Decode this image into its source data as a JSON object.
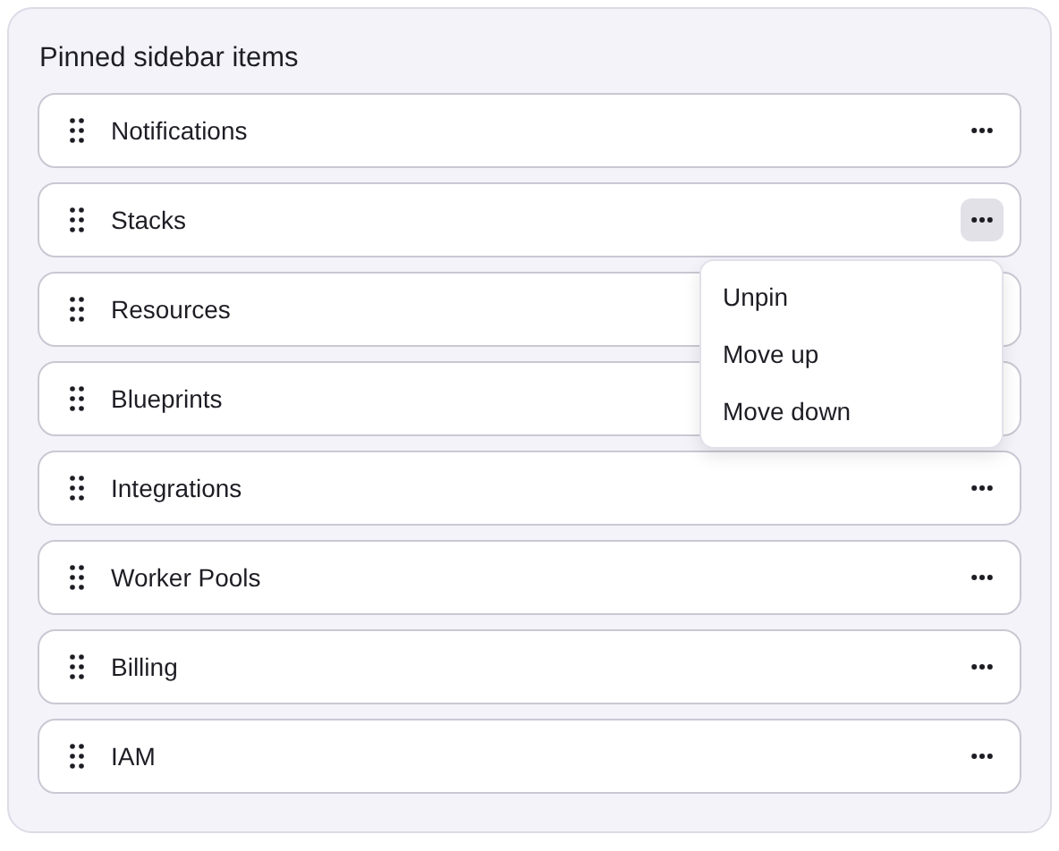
{
  "title": "Pinned sidebar items",
  "items": [
    {
      "label": "Notifications",
      "menu_open": false,
      "menu_button_covered": false
    },
    {
      "label": "Stacks",
      "menu_open": true,
      "menu_button_covered": false
    },
    {
      "label": "Resources",
      "menu_open": false,
      "menu_button_covered": true
    },
    {
      "label": "Blueprints",
      "menu_open": false,
      "menu_button_covered": true
    },
    {
      "label": "Integrations",
      "menu_open": false,
      "menu_button_covered": false
    },
    {
      "label": "Worker Pools",
      "menu_open": false,
      "menu_button_covered": false
    },
    {
      "label": "Billing",
      "menu_open": false,
      "menu_button_covered": false
    },
    {
      "label": "IAM",
      "menu_open": false,
      "menu_button_covered": false
    }
  ],
  "context_menu": [
    "Unpin",
    "Move up",
    "Move down"
  ]
}
